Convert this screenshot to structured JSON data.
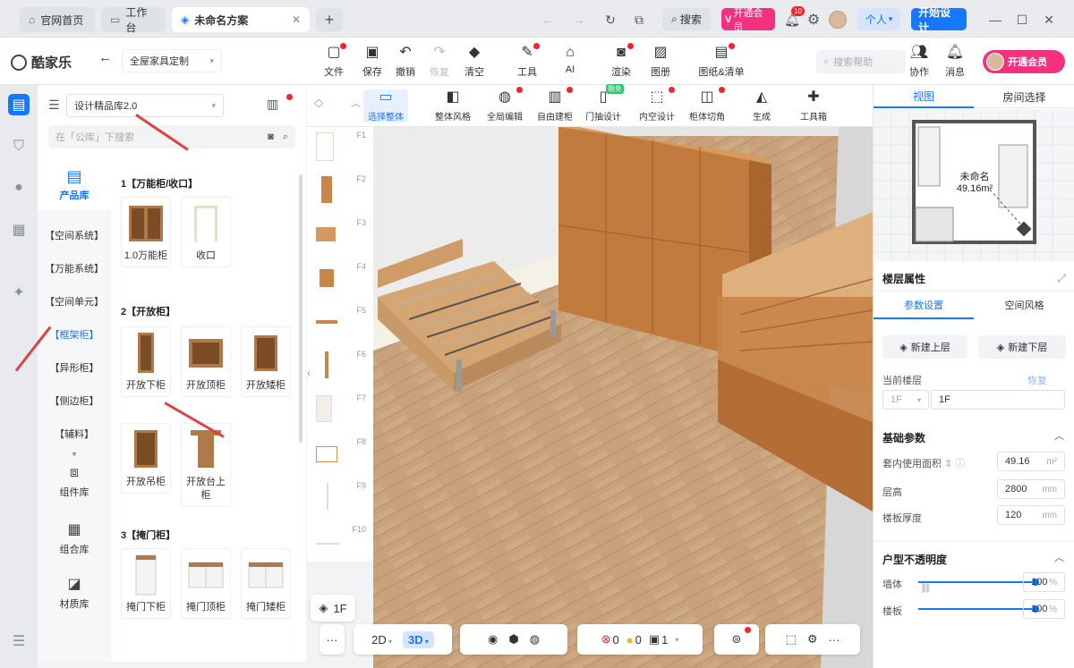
{
  "tabs": [
    {
      "label": "官网首页",
      "icon": "home-icon"
    },
    {
      "label": "工作台",
      "icon": "desktop-icon"
    },
    {
      "label": "未命名方案",
      "icon": "design-icon"
    }
  ],
  "titlebar": {
    "search_label": "搜索",
    "vip_badge": "开通会员",
    "notif_count": "10",
    "personal_label": "个人",
    "start_design": "开始设计"
  },
  "app": {
    "logo": "酷家乐",
    "mode": "全屋家具定制"
  },
  "toolbar": {
    "items": [
      {
        "label": "文件",
        "icon": "file-icon"
      },
      {
        "label": "保存",
        "icon": "save-icon"
      },
      {
        "label": "撤销",
        "icon": "undo-icon"
      },
      {
        "label": "恢复",
        "icon": "redo-icon"
      },
      {
        "label": "清空",
        "icon": "eraser-icon"
      },
      {
        "label": "工具",
        "icon": "wrench-icon"
      },
      {
        "label": "AI",
        "icon": "ai-icon"
      },
      {
        "label": "渲染",
        "icon": "camera-icon"
      },
      {
        "label": "图册",
        "icon": "album-icon"
      },
      {
        "label": "图纸&清单",
        "icon": "drawing-list-icon"
      }
    ],
    "search_placeholder": "搜索帮助",
    "collab": "协作",
    "message": "消息",
    "vip": "开通会员"
  },
  "library": {
    "selector": "设计精品库2.0",
    "search_placeholder": "在「公库」下搜索",
    "main_tab": "产品库",
    "categories": [
      "【空间系统】",
      "【万能系统】",
      "【空间单元】",
      "【框架柜】",
      "【异形柜】",
      "【侧边柜】",
      "【辅料】"
    ],
    "bottom_tabs": [
      "组件库",
      "组合库",
      "材质库"
    ],
    "sections": [
      {
        "title": "1【万能柜/收口】",
        "items": [
          "1.0万能柜",
          "收口"
        ]
      },
      {
        "title": "2【开放柜】",
        "items": [
          "开放下柜",
          "开放顶柜",
          "开放矮柜",
          "开放吊柜",
          "开放台上柜"
        ]
      },
      {
        "title": "3【掩门柜】",
        "items": [
          "掩门下柜",
          "掩门顶柜",
          "掩门矮柜"
        ]
      }
    ]
  },
  "floors": [
    "F1",
    "F2",
    "F3",
    "F4",
    "F5",
    "F6",
    "F7",
    "F8",
    "F9",
    "F10"
  ],
  "tool_strip": [
    {
      "label": "选择整体",
      "icon": "select-icon"
    },
    {
      "label": "整体风格",
      "icon": "style-icon"
    },
    {
      "label": "全局编辑",
      "icon": "global-edit-icon"
    },
    {
      "label": "自由建柜",
      "icon": "build-cabinet-icon"
    },
    {
      "label": "门抽设计",
      "icon": "door-drawer-icon"
    },
    {
      "label": "内空设计",
      "icon": "interior-icon"
    },
    {
      "label": "柜体切角",
      "icon": "chamfer-icon"
    },
    {
      "label": "生成",
      "icon": "generate-icon"
    },
    {
      "label": "工具箱",
      "icon": "toolbox-icon"
    }
  ],
  "tool_strip_badge": "限免",
  "bottom_bar": {
    "floor": "1F",
    "view_2d": "2D",
    "view_3d": "3D",
    "errors": "0",
    "warnings": "0",
    "count": "1"
  },
  "right_panel": {
    "tabs": [
      "视图",
      "房间选择"
    ],
    "room_name": "未命名",
    "room_area": "49.16m²",
    "prop_title": "楼层属性",
    "prop_tabs": [
      "参数设置",
      "空间风格"
    ],
    "new_up": "新建上层",
    "new_down": "新建下层",
    "current_floor_label": "当前楼层",
    "restore": "恢复",
    "floor_select": "1F",
    "floor_name": "1F",
    "basic_title": "基础参数",
    "area_label": "套内使用面积",
    "area_value": "49.16",
    "area_unit": "m²",
    "height_label": "层高",
    "height_value": "2800",
    "height_unit": "mm",
    "slab_label": "楼板厚度",
    "slab_value": "120",
    "slab_unit": "mm",
    "opacity_title": "户型不透明度",
    "wall_label": "墙体",
    "wall_value": "100",
    "floor_label": "楼板",
    "floor_value": "100",
    "pct": "%"
  },
  "colors": {
    "accent": "#1677ff",
    "vip": "#f5317f",
    "annotation": "#e04040",
    "wood": "#c9854a"
  }
}
